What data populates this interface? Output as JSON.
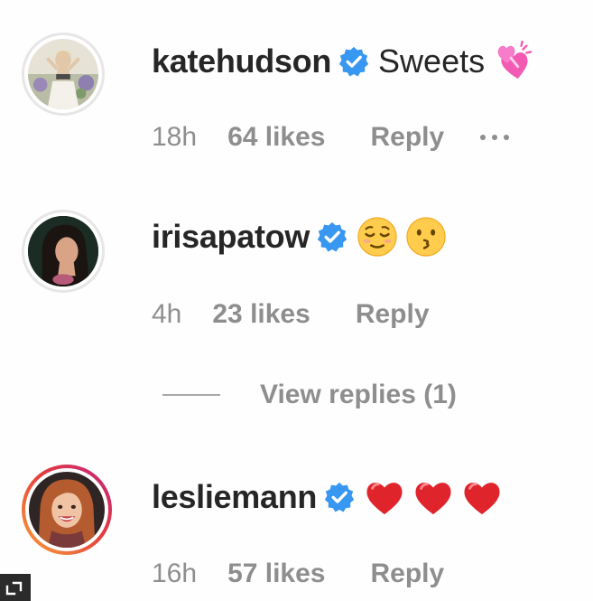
{
  "comments": [
    {
      "username": "katehudson",
      "text": "Sweets",
      "emojis": [
        "revolving-hearts"
      ],
      "time": "18h",
      "likes": "64 likes",
      "reply": "Reply",
      "has_more": true,
      "story_ring": false
    },
    {
      "username": "irisapatow",
      "text": "",
      "emojis": [
        "relieved-face",
        "kissing-face"
      ],
      "time": "4h",
      "likes": "23 likes",
      "reply": "Reply",
      "has_more": false,
      "story_ring": false
    },
    {
      "username": "lesliemann",
      "text": "",
      "emojis": [
        "red-heart",
        "red-heart",
        "red-heart"
      ],
      "time": "16h",
      "likes": "57 likes",
      "reply": "Reply",
      "has_more": false,
      "story_ring": true
    }
  ],
  "view_replies": "View replies (1)",
  "colors": {
    "text": "#262626",
    "meta": "#8e8e8e",
    "verified": "#3897f0",
    "heart": "#e0242c"
  },
  "icons": {
    "verified": "verified-badge-icon",
    "more": "more-options-icon",
    "expand": "expand-icon"
  }
}
